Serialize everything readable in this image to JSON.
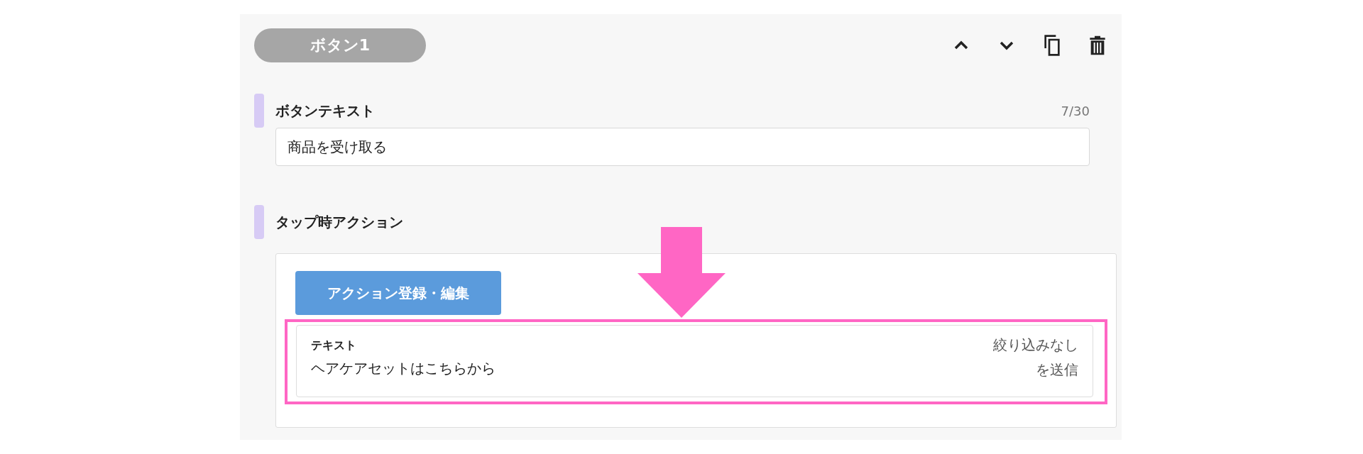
{
  "block": {
    "title": "ボタン1"
  },
  "fields": [
    {
      "label": "ボタンテキスト",
      "counter": "7/30",
      "value": "商品を受け取る"
    }
  ],
  "action": {
    "label": "タップ時アクション",
    "button": "アクション登録・編集",
    "card": {
      "type": "テキスト",
      "text": "ヘアケアセットはこちらから",
      "filter": "絞り込みなし",
      "send": "を送信"
    }
  }
}
